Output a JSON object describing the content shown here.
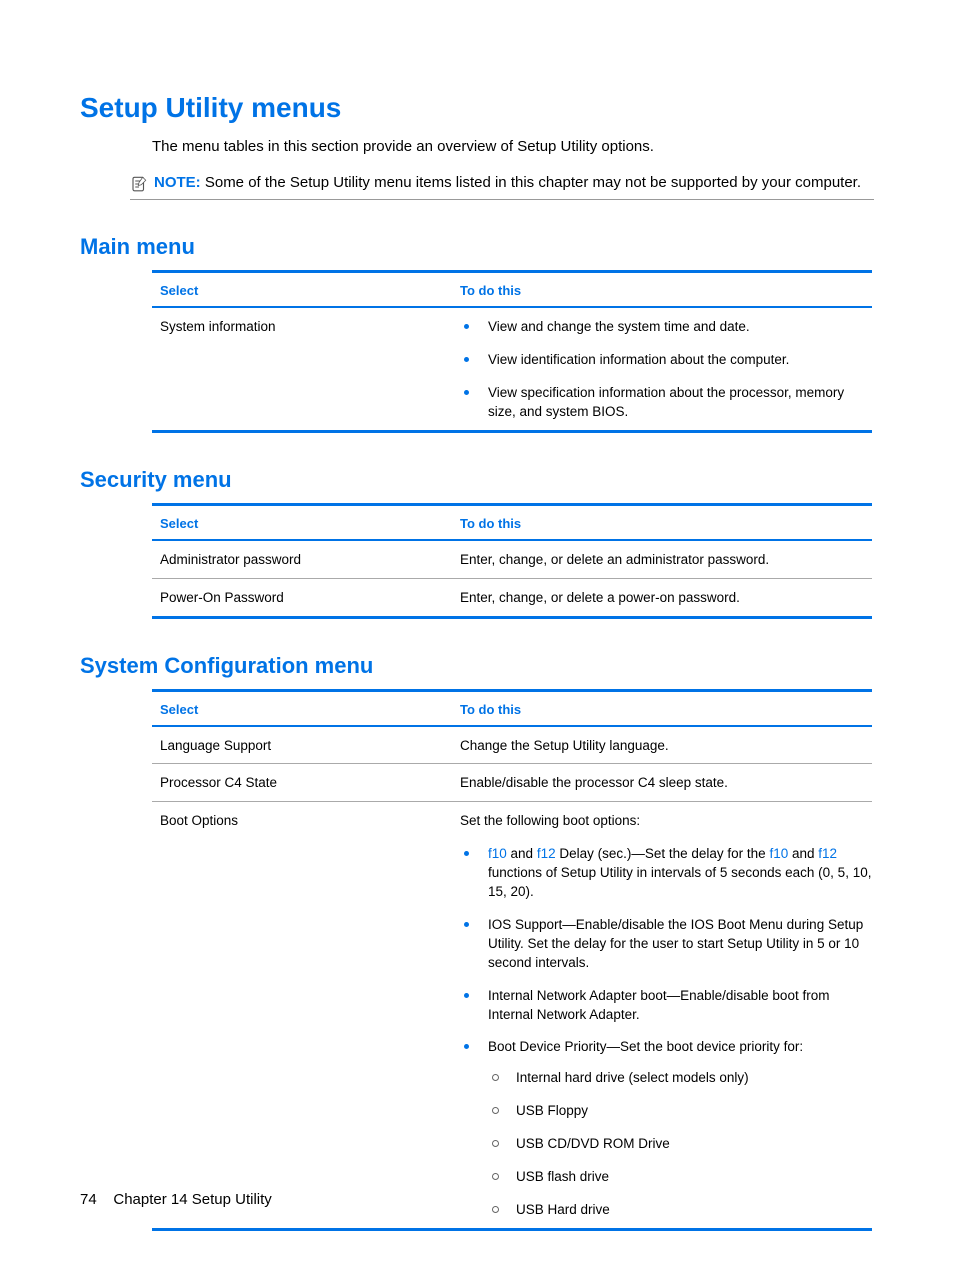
{
  "title": "Setup Utility menus",
  "intro": "The menu tables in this section provide an overview of Setup Utility options.",
  "note_label": "NOTE:",
  "note_text": "Some of the Setup Utility menu items listed in this chapter may not be supported by your computer.",
  "headers": {
    "select": "Select",
    "todo": "To do this"
  },
  "main": {
    "heading": "Main menu",
    "rows": [
      {
        "select": "System information",
        "bullets": [
          "View and change the system time and date.",
          "View identification information about the computer.",
          "View specification information about the processor, memory size, and system BIOS."
        ]
      }
    ]
  },
  "security": {
    "heading": "Security menu",
    "rows": [
      {
        "select": "Administrator password",
        "todo": "Enter, change, or delete an administrator password."
      },
      {
        "select": "Power-On Password",
        "todo": "Enter, change, or delete a power-on password."
      }
    ]
  },
  "sysconf": {
    "heading": "System Configuration menu",
    "rows": [
      {
        "select": "Language Support",
        "todo": "Change the Setup Utility language."
      },
      {
        "select": "Processor C4 State",
        "todo": "Enable/disable the processor C4 sleep state."
      }
    ],
    "boot": {
      "select": "Boot Options",
      "lead": "Set the following boot options:",
      "f10": "f10",
      "f12": "f12",
      "b1_a": " and ",
      "b1_b": " Delay (sec.)—Set the delay for the ",
      "b1_c": " and ",
      "b1_d": " functions of Setup Utility in intervals of 5 seconds each (0, 5, 10, 15, 20).",
      "b2": "IOS Support—Enable/disable the IOS Boot Menu during Setup Utility. Set the delay for the user to start Setup Utility in 5 or 10 second intervals.",
      "b3": "Internal Network Adapter boot—Enable/disable boot from Internal Network Adapter.",
      "b4": "Boot Device Priority—Set the boot device priority for:",
      "sub": [
        "Internal hard drive (select models only)",
        "USB Floppy",
        "USB CD/DVD ROM Drive",
        "USB flash drive",
        "USB Hard drive"
      ]
    }
  },
  "footer": {
    "page": "74",
    "chapter": "Chapter 14   Setup Utility"
  }
}
